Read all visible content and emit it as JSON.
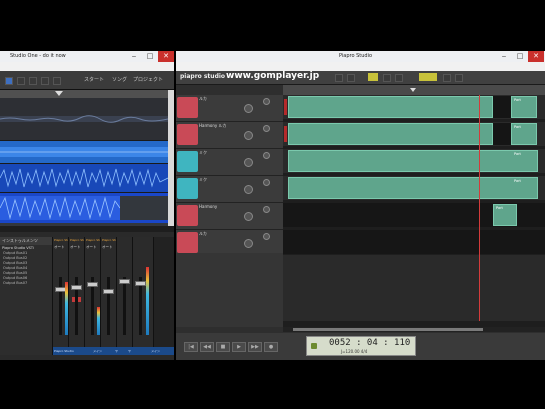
{
  "studio_one": {
    "title": "Studio One - do it now",
    "window_controls": [
      "‒",
      "□",
      "✕"
    ],
    "menu": [
      "ファイル",
      "ソングエディット",
      "オプション",
      "表示",
      "Studio One",
      "ヘルプ"
    ],
    "toolbar": {
      "start_label": "スタート",
      "song_label": "ソング",
      "project_label": "プロジェクト"
    },
    "instrument_panel": {
      "header": "インストゥルメンツ",
      "device": "Piapro Studio VSTi",
      "items": [
        "Output Bus01",
        "Output Bus02",
        "Output Bus03",
        "Output Bus04",
        "Output Bus05",
        "Output Bus06",
        "Output Bus07"
      ]
    },
    "mixer": {
      "channels": [
        {
          "name": "Piapro Studio",
          "label": "オート"
        },
        {
          "name": "Piapro Studio",
          "label": "オート"
        },
        {
          "name": "Piapro Studio",
          "label": "オート"
        },
        {
          "name": "Piapro Studio",
          "label": "オート"
        }
      ],
      "bottom_labels": [
        "Piapro Studio",
        "メイン",
        "ヤ",
        "ヤ",
        "メイン"
      ]
    }
  },
  "piapro": {
    "title": "Piapro Studio",
    "window_controls": [
      "‒",
      "□",
      "✕"
    ],
    "menu": [
      "ファイル",
      "編集",
      "トラック",
      "パート",
      "ジョブ",
      "表示",
      "設定",
      "ヘルプ"
    ],
    "logo": "piapro studio",
    "watermark": "www.gomplayer.jp",
    "tracks": [
      {
        "name": "ルカ",
        "avatar_color": "#c94a57",
        "part_label": "Part"
      },
      {
        "name": "Harmony ルカ",
        "avatar_color": "#c94a57",
        "part_label": "Part"
      },
      {
        "name": "ミク",
        "avatar_color": "#3fb5c0",
        "part_label": "Part"
      },
      {
        "name": "ミク",
        "avatar_color": "#3fb5c0",
        "part_label": "Part"
      },
      {
        "name": "Harmony",
        "avatar_color": "#c94a57",
        "part_label": "Part"
      },
      {
        "name": "ルカ",
        "avatar_color": "#c94a57",
        "part_label": ""
      }
    ],
    "transport": {
      "position": "0052 : 04 : 110",
      "tempo": "J=120.00  4/4"
    }
  },
  "colors": {
    "clip_green": "#5fa58c",
    "wave_blue": "#1c5bd6",
    "playhead_red": "#d43b3b"
  }
}
